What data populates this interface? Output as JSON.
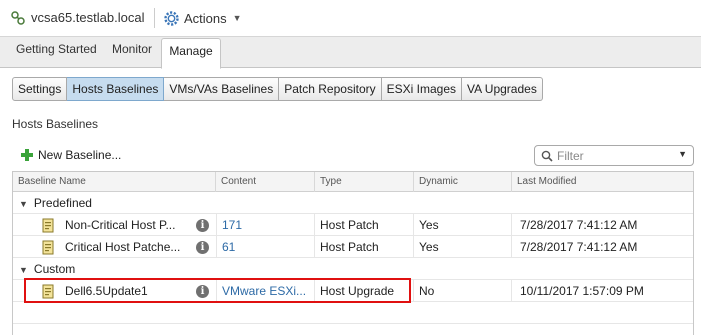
{
  "header": {
    "host_name": "vcsa65.testlab.local",
    "actions_label": "Actions"
  },
  "nav_tabs": [
    {
      "label": "Getting Started",
      "active": false
    },
    {
      "label": "Monitor",
      "active": false
    },
    {
      "label": "Manage",
      "active": true
    }
  ],
  "sub_tabs": [
    {
      "label": "Settings",
      "active": false
    },
    {
      "label": "Hosts Baselines",
      "active": true
    },
    {
      "label": "VMs/VAs Baselines",
      "active": false
    },
    {
      "label": "Patch Repository",
      "active": false
    },
    {
      "label": "ESXi Images",
      "active": false
    },
    {
      "label": "VA Upgrades",
      "active": false
    }
  ],
  "section_title": "Hosts Baselines",
  "toolbar": {
    "new_baseline_label": "New Baseline...",
    "filter_placeholder": "Filter"
  },
  "table": {
    "columns": [
      "Baseline Name",
      "Content",
      "Type",
      "Dynamic",
      "Last Modified"
    ],
    "groups": [
      {
        "label": "Predefined",
        "rows": [
          {
            "name": "Non-Critical Host P...",
            "content": "171",
            "type": "Host Patch",
            "dynamic": "Yes",
            "last_modified": "7/28/2017 7:41:12 AM"
          },
          {
            "name": "Critical Host Patche...",
            "content": "61",
            "type": "Host Patch",
            "dynamic": "Yes",
            "last_modified": "7/28/2017 7:41:12 AM"
          }
        ]
      },
      {
        "label": "Custom",
        "rows": [
          {
            "name": "Dell6.5Update1",
            "content": "VMware ESXi...",
            "type": "Host Upgrade",
            "dynamic": "No",
            "last_modified": "10/11/2017 1:57:09 PM"
          }
        ]
      }
    ]
  },
  "colors": {
    "link": "#2d6aa6",
    "active_tab": "#c6dcef",
    "highlight": "#e01010"
  }
}
